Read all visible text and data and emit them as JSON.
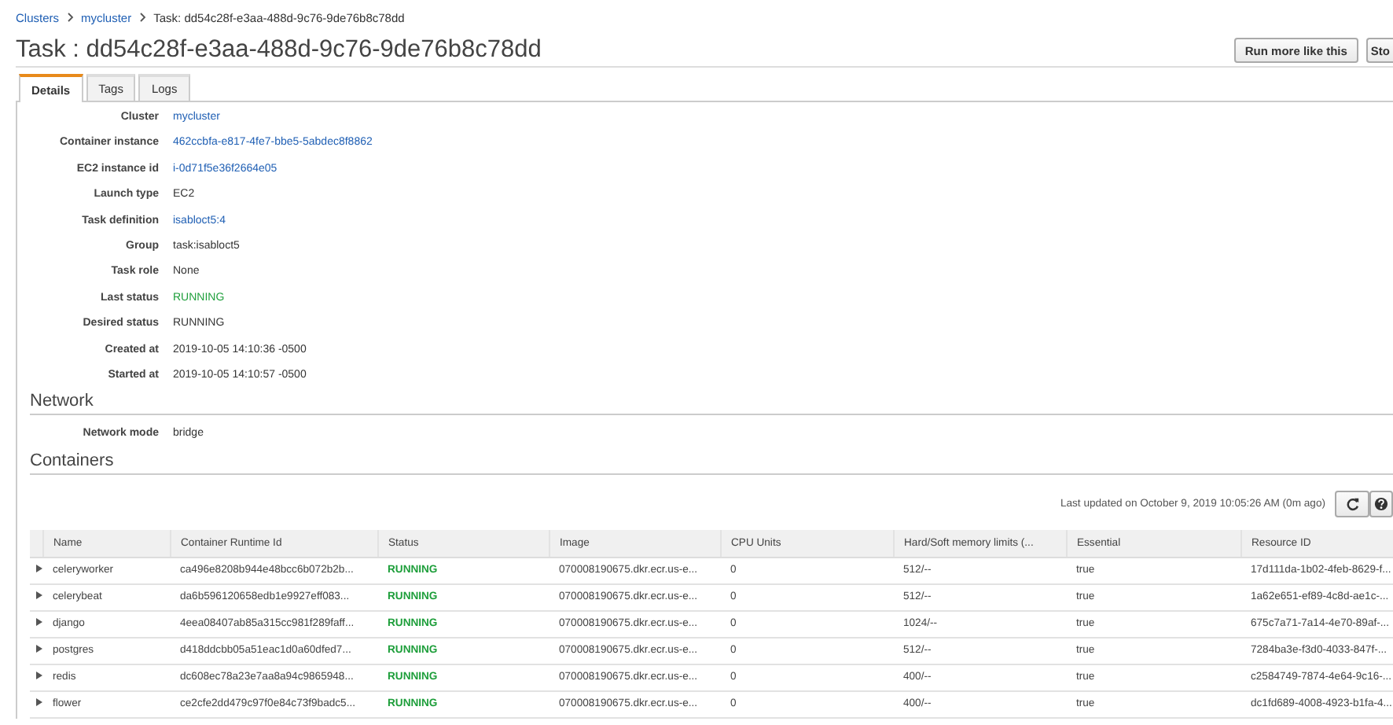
{
  "breadcrumb": [
    {
      "label": "Clusters",
      "kind": "link"
    },
    {
      "label": "mycluster",
      "kind": "link"
    },
    {
      "label": "Task: dd54c28f-e3aa-488d-9c76-9de76b8c78dd",
      "kind": "text"
    }
  ],
  "title": "Task : dd54c28f-e3aa-488d-9c76-9de76b8c78dd",
  "actions": [
    "Run more like this",
    "Sto"
  ],
  "tabs": [
    {
      "label": "Details",
      "selected": true
    },
    {
      "label": "Tags",
      "selected": false
    },
    {
      "label": "Logs",
      "selected": false
    }
  ],
  "details": [
    {
      "label": "Cluster",
      "value": "mycluster",
      "kind": "link"
    },
    {
      "label": "Container instance",
      "value": "462ccbfa-e817-4fe7-bbe5-5abdec8f8862",
      "kind": "link"
    },
    {
      "label": "EC2 instance id",
      "value": "i-0d71f5e36f2664e05",
      "kind": "link"
    },
    {
      "label": "Launch type",
      "value": "EC2",
      "kind": "text"
    },
    {
      "label": "Task definition",
      "value": "isabloct5:4",
      "kind": "link"
    },
    {
      "label": "Group",
      "value": "task:isabloct5",
      "kind": "text"
    },
    {
      "label": "Task role",
      "value": "None",
      "kind": "text"
    },
    {
      "label": "Last status",
      "value": "RUNNING",
      "kind": "status"
    },
    {
      "label": "Desired status",
      "value": "RUNNING",
      "kind": "text"
    },
    {
      "label": "Created at",
      "value": "2019-10-05 14:10:36 -0500",
      "kind": "text"
    },
    {
      "label": "Started at",
      "value": "2019-10-05 14:10:57 -0500",
      "kind": "text"
    }
  ],
  "network": {
    "heading": "Network",
    "label": "Network mode",
    "value": "bridge"
  },
  "containers": {
    "heading": "Containers",
    "last_updated": "Last updated on October 9, 2019 10:05:26 AM (0m ago)",
    "columns": [
      "Name",
      "Container Runtime Id",
      "Status",
      "Image",
      "CPU Units",
      "Hard/Soft memory limits (...",
      "Essential",
      "Resource ID"
    ],
    "rows": [
      {
        "expanded": false,
        "cells": [
          "celeryworker",
          "ca496e8208b944e48bcc6b072b2b...",
          "RUNNING",
          "070008190675.dkr.ecr.us-e...",
          "0",
          "512/--",
          "true",
          "17d111da-1b02-4feb-8629-f..."
        ]
      },
      {
        "expanded": false,
        "cells": [
          "celerybeat",
          "da6b596120658edb1e9927eff083...",
          "RUNNING",
          "070008190675.dkr.ecr.us-e...",
          "0",
          "512/--",
          "true",
          "1a62e651-ef89-4c8d-ae1c-..."
        ]
      },
      {
        "expanded": false,
        "cells": [
          "django",
          "4eea08407ab85a315cc981f289faff...",
          "RUNNING",
          "070008190675.dkr.ecr.us-e...",
          "0",
          "1024/--",
          "true",
          "675c7a71-7a14-4e70-89af-..."
        ]
      },
      {
        "expanded": false,
        "cells": [
          "postgres",
          "d418ddcbb05a51eac1d0a60dfed7...",
          "RUNNING",
          "070008190675.dkr.ecr.us-e...",
          "0",
          "512/--",
          "true",
          "7284ba3e-f3d0-4033-847f-..."
        ]
      },
      {
        "expanded": false,
        "cells": [
          "redis",
          "dc608ec78a23e7aa8a94c9865948...",
          "RUNNING",
          "070008190675.dkr.ecr.us-e...",
          "0",
          "400/--",
          "true",
          "c2584749-7874-4e64-9c16-..."
        ]
      },
      {
        "expanded": false,
        "cells": [
          "flower",
          "ce2cfe2dd479c97f0e84c73f9badc5...",
          "RUNNING",
          "070008190675.dkr.ecr.us-e...",
          "0",
          "400/--",
          "true",
          "dc1fd689-4008-4923-b1fa-4..."
        ]
      }
    ]
  }
}
